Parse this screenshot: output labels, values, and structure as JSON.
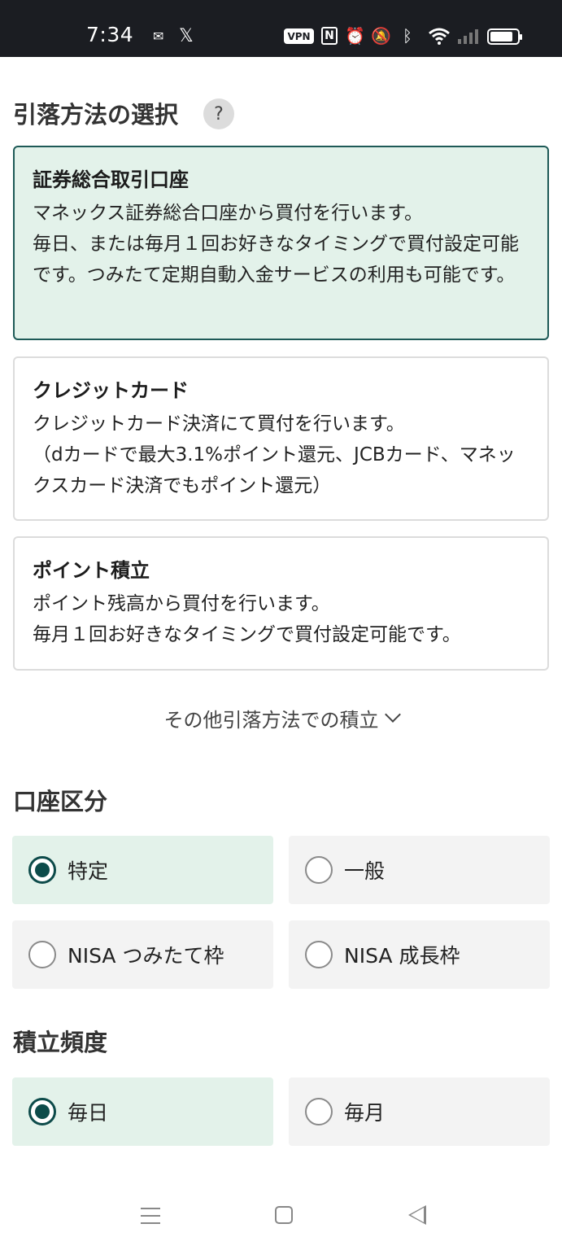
{
  "status_bar": {
    "time": "7:34",
    "vpn": "VPN",
    "nfc": "N",
    "icons": [
      "sim-icon",
      "x-icon",
      "vpn-icon",
      "nfc-icon",
      "alarm-icon",
      "mute-icon",
      "bluetooth-icon",
      "wifi-icon",
      "signal-icon",
      "battery-icon"
    ]
  },
  "withdrawal": {
    "title": "引落方法の選択",
    "help": "?",
    "options": [
      {
        "title": "証券総合取引口座",
        "desc": "マネックス証券総合口座から買付を行います。\n毎日、または毎月１回お好きなタイミングで買付設定可能です。つみたて定期自動入金サービスの利用も可能です。",
        "selected": true
      },
      {
        "title": "クレジットカード",
        "desc": "クレジットカード決済にて買付を行います。\n（dカードで最大3.1%ポイント還元、JCBカード、マネックスカード決済でもポイント還元）",
        "selected": false
      },
      {
        "title": "ポイント積立",
        "desc": "ポイント残高から買付を行います。\n毎月１回お好きなタイミングで買付設定可能です。",
        "selected": false
      }
    ],
    "more_label": "その他引落方法での積立"
  },
  "account_type": {
    "title": "口座区分",
    "options": [
      {
        "label": "特定",
        "selected": true
      },
      {
        "label": "一般",
        "selected": false
      },
      {
        "label": "NISA つみたて枠",
        "selected": false
      },
      {
        "label": "NISA 成長枠",
        "selected": false
      }
    ]
  },
  "frequency": {
    "title": "積立頻度",
    "options": [
      {
        "label": "毎日",
        "selected": true
      },
      {
        "label": "毎月",
        "selected": false
      }
    ]
  },
  "colors": {
    "selected_bg": "#e3f2ea",
    "accent": "#0d4b4a",
    "status_bar_bg": "#1b1d22"
  }
}
